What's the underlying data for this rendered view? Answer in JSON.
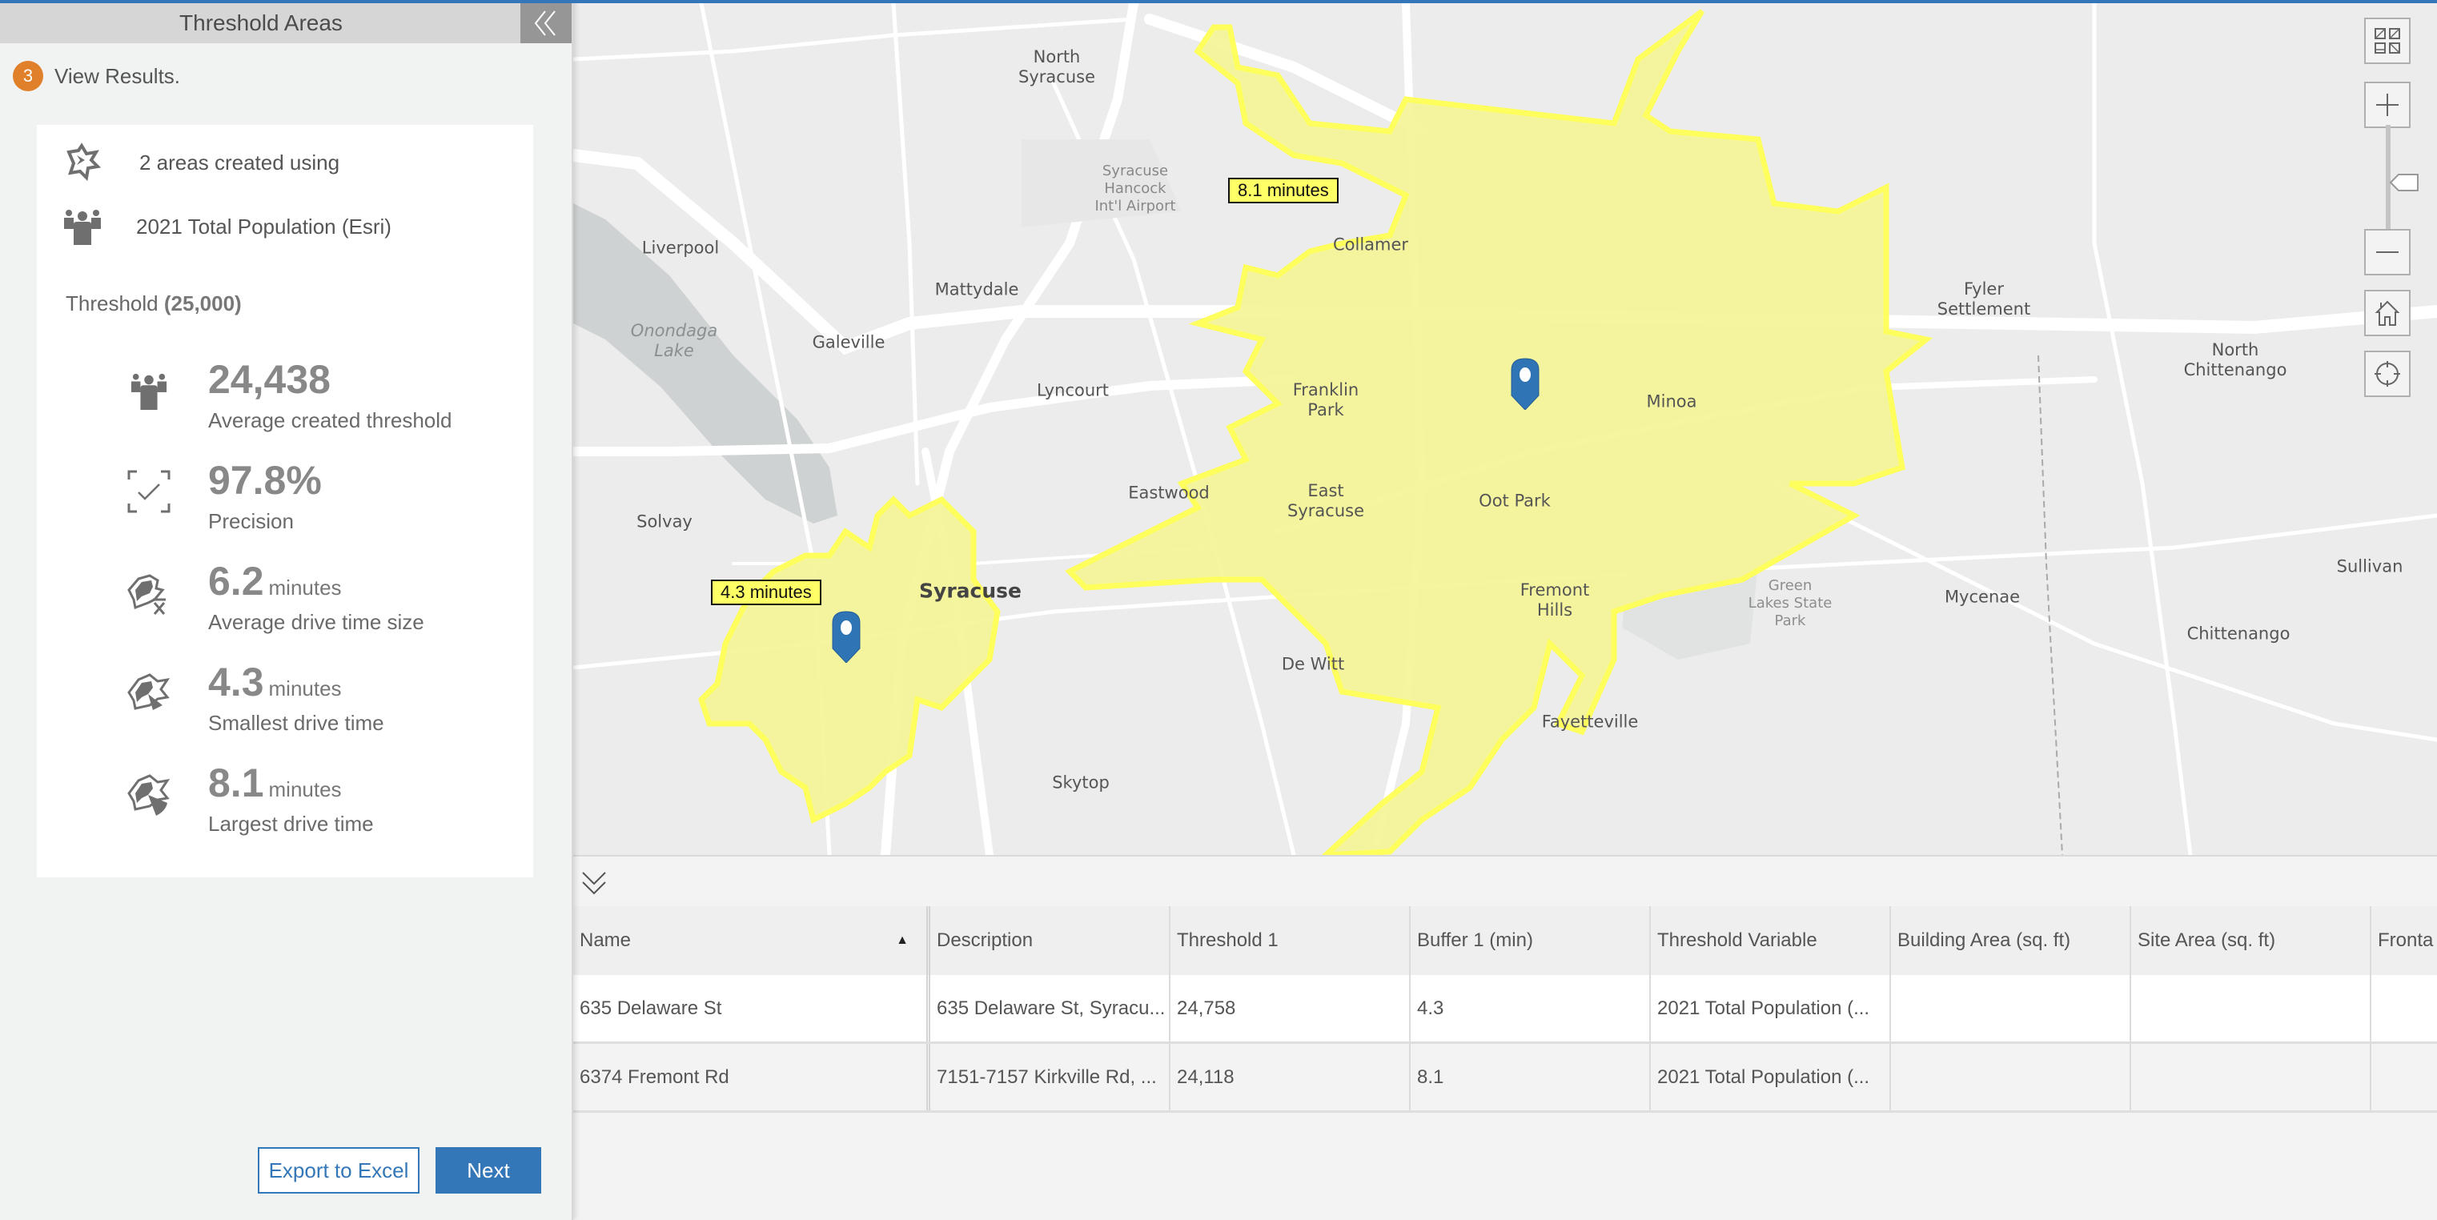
{
  "sidebar": {
    "title": "Threshold Areas",
    "collapse_icon": "double-chevron-left-icon",
    "step": {
      "number": "3",
      "text": "View Results."
    },
    "summary": {
      "areas_text": "2 areas created using",
      "variable_text": "2021 Total Population (Esri)"
    },
    "threshold": {
      "label": "Threshold",
      "value": "(25,000)"
    },
    "stats": [
      {
        "icon": "population-icon",
        "value": "24,438",
        "unit": "",
        "label": "Average created threshold"
      },
      {
        "icon": "precision-check-icon",
        "value": "97.8%",
        "unit": "",
        "label": "Precision"
      },
      {
        "icon": "drive-time-average-icon",
        "value": "6.2",
        "unit": "minutes",
        "label": "Average drive time size"
      },
      {
        "icon": "drive-time-smallest-icon",
        "value": "4.3",
        "unit": "minutes",
        "label": "Smallest drive time"
      },
      {
        "icon": "drive-time-largest-icon",
        "value": "8.1",
        "unit": "minutes",
        "label": "Largest drive time"
      }
    ],
    "buttons": {
      "export": "Export to Excel",
      "next": "Next"
    }
  },
  "map": {
    "areas": [
      {
        "label": "4.3 minutes",
        "fill": "#f5f59a",
        "outline": "#ffff55"
      },
      {
        "label": "8.1 minutes",
        "fill": "#f5f59a",
        "outline": "#ffff55"
      }
    ],
    "pin_color": "#2f74b5",
    "places": [
      {
        "name": "North\nSyracuse",
        "type": "town"
      },
      {
        "name": "Syracuse\nHancock\nInt'l Airport",
        "type": "airport"
      },
      {
        "name": "Collamer",
        "type": "town"
      },
      {
        "name": "Liverpool",
        "type": "town"
      },
      {
        "name": "Mattydale",
        "type": "town"
      },
      {
        "name": "Onondaga\nLake",
        "type": "water"
      },
      {
        "name": "Galeville",
        "type": "town"
      },
      {
        "name": "Lyncourt",
        "type": "town"
      },
      {
        "name": "Franklin\nPark",
        "type": "town"
      },
      {
        "name": "Fyler\nSettlement",
        "type": "town"
      },
      {
        "name": "North\nChittenango",
        "type": "town"
      },
      {
        "name": "Minoa",
        "type": "town"
      },
      {
        "name": "Eastwood",
        "type": "town"
      },
      {
        "name": "East\nSyracuse",
        "type": "town"
      },
      {
        "name": "Oot Park",
        "type": "town"
      },
      {
        "name": "Solvay",
        "type": "town"
      },
      {
        "name": "Syracuse",
        "type": "city"
      },
      {
        "name": "Fremont\nHills",
        "type": "town"
      },
      {
        "name": "Green\nLakes State\nPark",
        "type": "park"
      },
      {
        "name": "Mycenae",
        "type": "town"
      },
      {
        "name": "Sullivan",
        "type": "town"
      },
      {
        "name": "Chittenango",
        "type": "town"
      },
      {
        "name": "De Witt",
        "type": "town"
      },
      {
        "name": "Fayetteville",
        "type": "town"
      },
      {
        "name": "Skytop",
        "type": "town"
      }
    ],
    "controls": [
      {
        "name": "basemap-gallery-button",
        "icon": "basemap-grid-icon"
      },
      {
        "name": "zoom-in-button",
        "icon": "plus-icon"
      },
      {
        "name": "zoom-out-button",
        "icon": "minus-icon"
      },
      {
        "name": "home-button",
        "icon": "home-icon"
      },
      {
        "name": "locate-button",
        "icon": "crosshair-icon"
      }
    ]
  },
  "table": {
    "toggle_icon": "double-chevron-down-icon",
    "columns": [
      "Name",
      "Description",
      "Threshold 1",
      "Buffer 1 (min)",
      "Threshold Variable",
      "Building Area (sq. ft)",
      "Site Area (sq. ft)",
      "Fronta"
    ],
    "sort": {
      "column": "Name",
      "direction": "ascending"
    },
    "rows": [
      [
        "635 Delaware St",
        "635 Delaware St, Syracu...",
        "24,758",
        "4.3",
        "2021 Total Population (...",
        "",
        "",
        ""
      ],
      [
        "6374 Fremont Rd",
        "7151-7157 Kirkville Rd, ...",
        "24,118",
        "8.1",
        "2021 Total Population (...",
        "",
        "",
        ""
      ]
    ]
  }
}
